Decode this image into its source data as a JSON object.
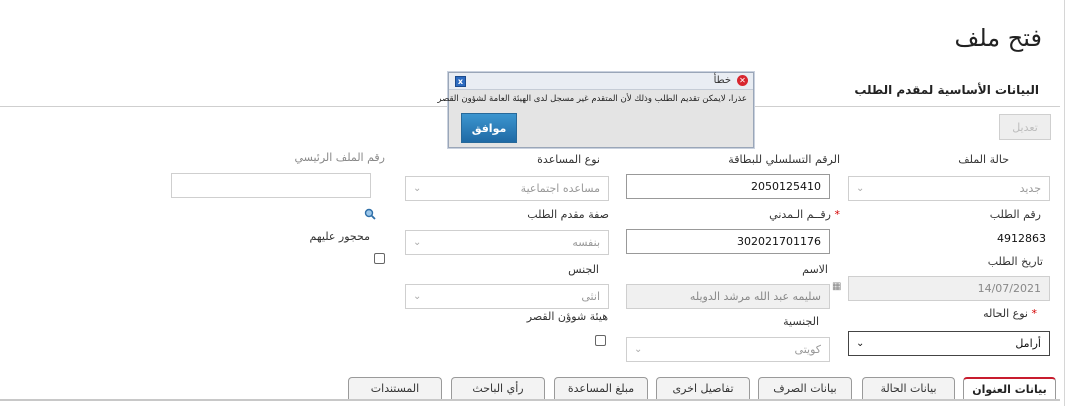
{
  "page_title": "فتح ملف",
  "section_title": "البيانات الأساسية لمقدم الطلب",
  "edit_button_label": "تعديل",
  "fields": {
    "file_status": {
      "label": "حالة الملف",
      "value": "جديد"
    },
    "request_number": {
      "label": "رقم الطلب",
      "value": "4912863"
    },
    "request_date": {
      "label": "تاريخ الطلب",
      "value": "14/07/2021"
    },
    "case_type": {
      "label": "نوع الحاله",
      "value": "أرامل"
    },
    "card_serial": {
      "label": "الرقم التسلسلي للبطاقة",
      "value": "2050125410"
    },
    "civil_number": {
      "label": "رقــم الـمدني",
      "value": "302021701176"
    },
    "name": {
      "label": "الاسم",
      "value": "سليمه عبد الله مرشد الدويله"
    },
    "nationality": {
      "label": "الجنسية",
      "value": "كويتى"
    },
    "aid_type": {
      "label": "نوع المساعدة",
      "value": "مساعده اجتماعية"
    },
    "applicant_capacity": {
      "label": "صفة مقدم الطلب",
      "value": "بنفسه"
    },
    "gender": {
      "label": "الجنس",
      "value": "انثى"
    },
    "minors_authority": {
      "label": "هيئة شوؤن القصر"
    },
    "main_file_number": {
      "label": "رقم الملف الرئيسي",
      "value": ""
    },
    "interdicted": {
      "label": "محجور عليهم"
    }
  },
  "tabs": [
    {
      "label": "بيانات العنوان",
      "active": true
    },
    {
      "label": "بيانات الحالة"
    },
    {
      "label": "بيانات الصرف"
    },
    {
      "label": "تفاصيل اخرى"
    },
    {
      "label": "مبلغ المساعدة"
    },
    {
      "label": "رأي الباحث"
    },
    {
      "label": "المستندات"
    }
  ],
  "error_dialog": {
    "title": "خطأ",
    "message": "عذرا، لايمكن تقديم الطلب وذلك لأن المتقدم غير مسجل لدى الهيئة العامة لشؤون القصر",
    "ok_label": "موافق"
  },
  "colors": {
    "accent": "#c81c2e",
    "button_blue": "#1f6aa5",
    "required": "#d40000"
  }
}
